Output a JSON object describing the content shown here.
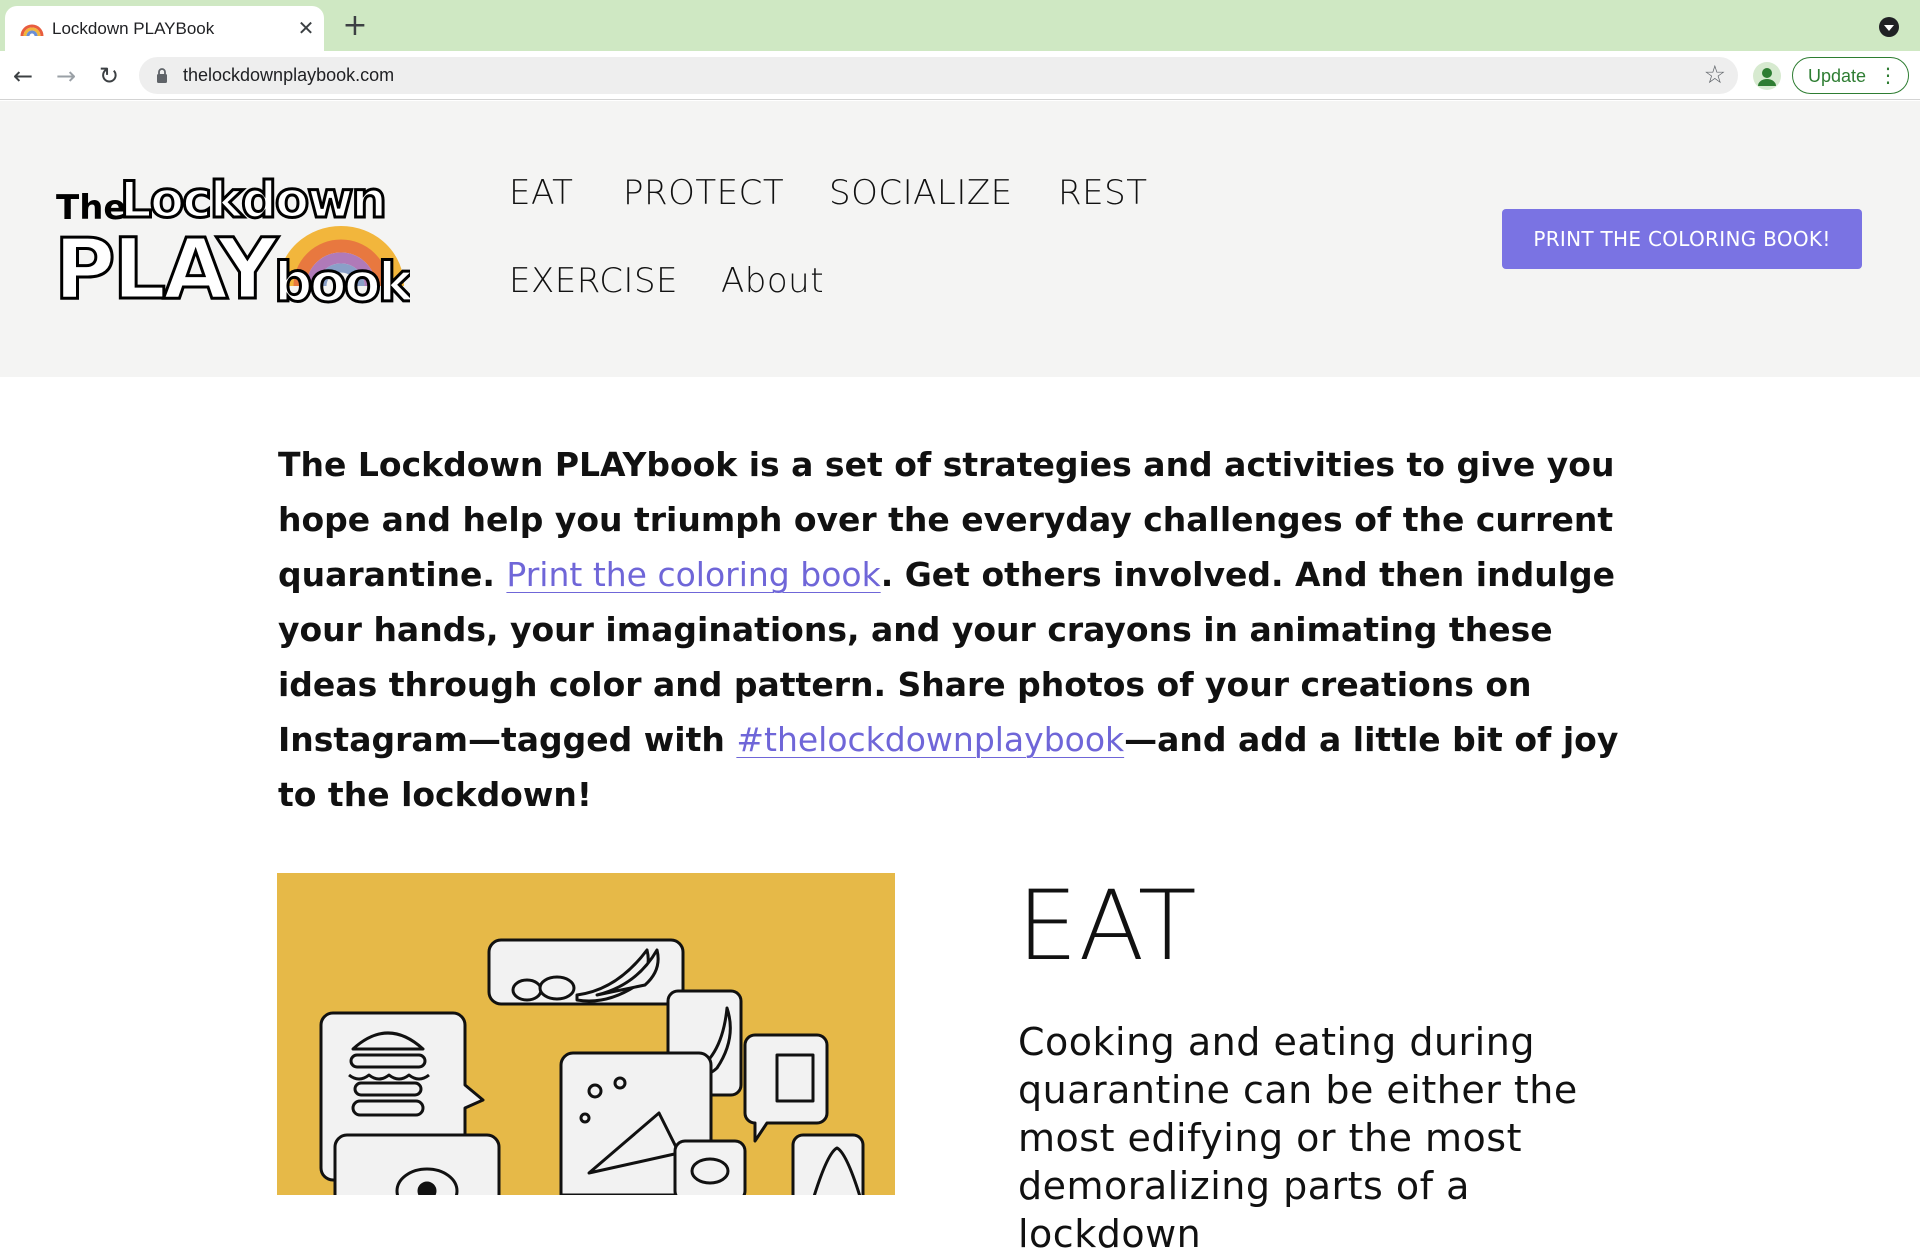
{
  "browser": {
    "tab_title": "Lockdown PLAYBook",
    "url": "thelockdownplaybook.com",
    "update_label": "Update"
  },
  "site": {
    "logo_alt": "The Lockdown PLAYbook",
    "nav": [
      "EAT",
      "PROTECT",
      "SOCIALIZE",
      "REST",
      "EXERCISE",
      "About"
    ],
    "cta_label": "PRINT THE COLORING BOOK!"
  },
  "intro": {
    "part1": "The Lockdown PLAYbook is a set of strategies and activities to give you hope and help you triumph over the everyday challenges of the current quarantine.",
    "link1": "Print the coloring book",
    "part2": ". Get others involved. And then indulge your hands, your imaginations, and your crayons in animating these ideas through color and pattern. Share photos of your creations on Instagram—tagged with",
    "link2": "#thelockdownplaybook",
    "part3": "—and add a little bit of joy to the lockdown!"
  },
  "eat_section": {
    "title": "EAT",
    "description": "Cooking and eating during quarantine can be either the most edifying or the most demoralizing parts of a lockdown"
  },
  "colors": {
    "tabstrip": "#cfe8c3",
    "accent": "#7a73e3",
    "link": "#6f66d8",
    "header_bg": "#f4f4f3",
    "eat_bg": "#e6b948"
  }
}
